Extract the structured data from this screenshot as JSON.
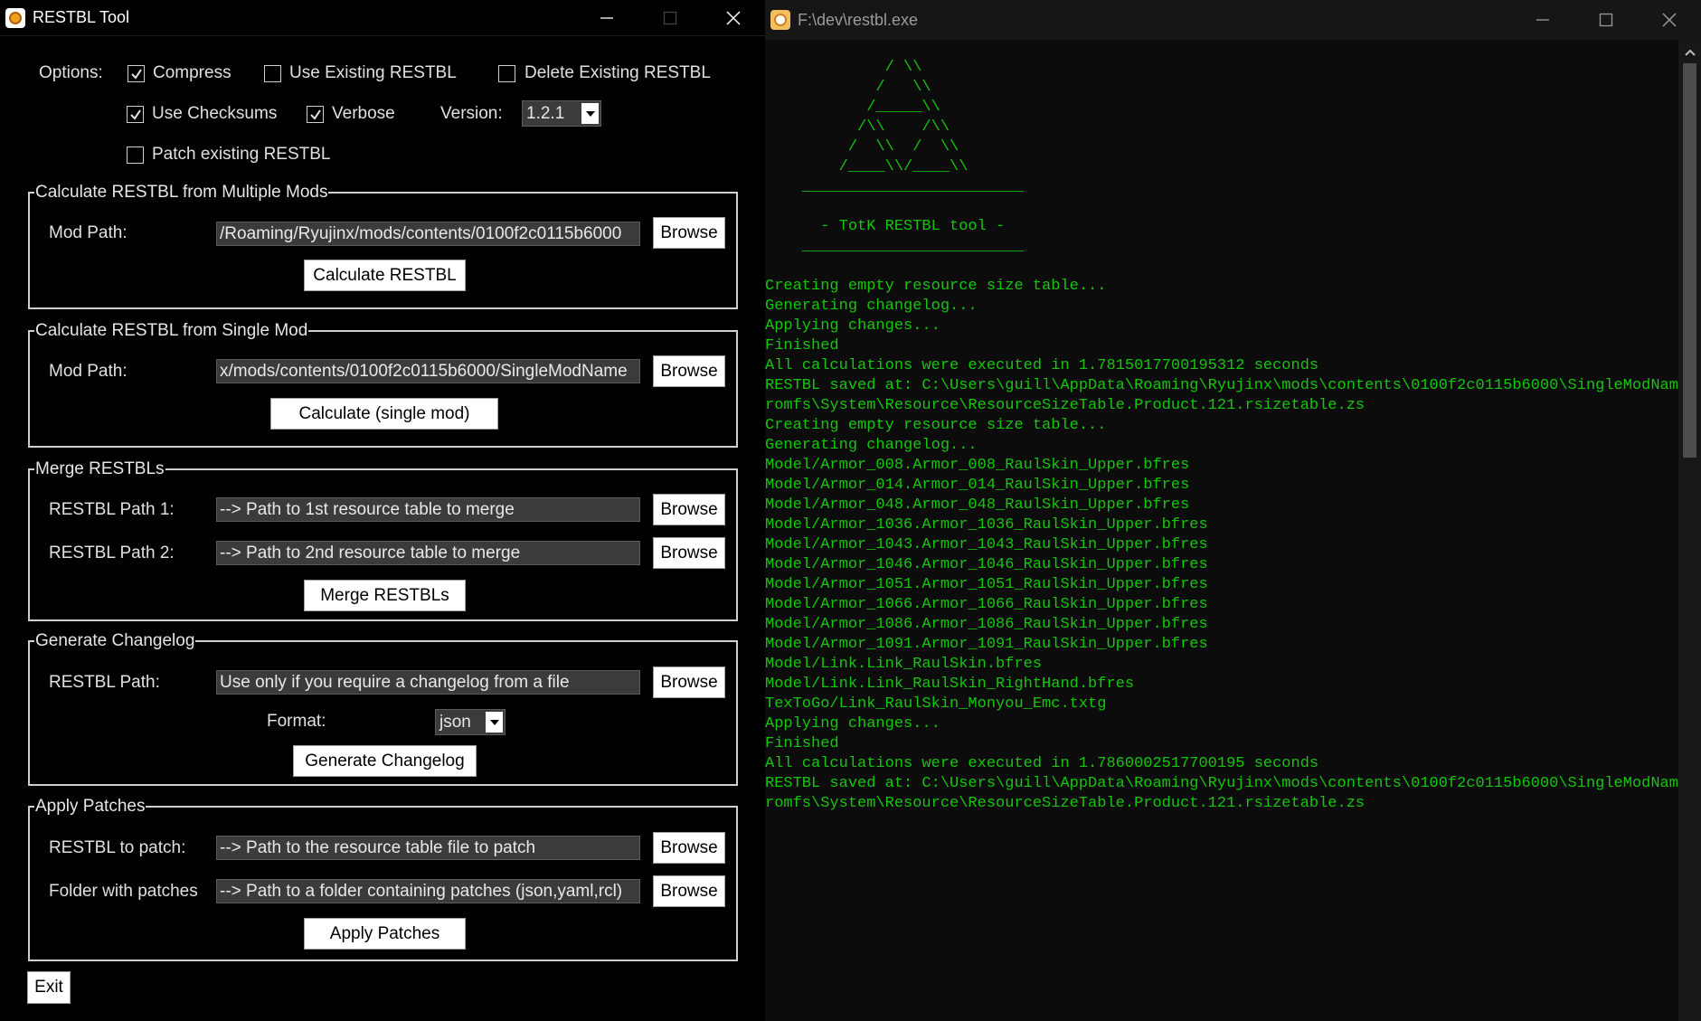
{
  "tool_window": {
    "title": "RESTBL Tool",
    "options": {
      "label": "Options:",
      "compress": {
        "label": "Compress",
        "checked": true
      },
      "use_existing": {
        "label": "Use Existing RESTBL",
        "checked": false
      },
      "delete_existing": {
        "label": "Delete Existing RESTBL",
        "checked": false
      },
      "use_checksums": {
        "label": "Use Checksums",
        "checked": true
      },
      "verbose": {
        "label": "Verbose",
        "checked": true
      },
      "version_label": "Version:",
      "version_value": "1.2.1",
      "patch_existing": {
        "label": "Patch existing RESTBL",
        "checked": false
      }
    },
    "multi": {
      "legend": "Calculate RESTBL from Multiple Mods",
      "mod_path_label": "Mod Path:",
      "mod_path_value": "/Roaming/Ryujinx/mods/contents/0100f2c0115b6000",
      "browse_label": "Browse",
      "calculate_label": "Calculate RESTBL"
    },
    "single": {
      "legend": "Calculate RESTBL from Single Mod",
      "mod_path_label": "Mod Path:",
      "mod_path_value": "x/mods/contents/0100f2c0115b6000/SingleModName",
      "browse_label": "Browse",
      "calculate_label": "Calculate (single mod)"
    },
    "merge": {
      "legend": "Merge RESTBLs",
      "path1_label": "RESTBL Path 1:",
      "path1_value": "--> Path to 1st resource table to merge",
      "path2_label": "RESTBL Path 2:",
      "path2_value": "--> Path to 2nd resource table to merge",
      "browse_label": "Browse",
      "merge_label": "Merge RESTBLs"
    },
    "changelog": {
      "legend": "Generate Changelog",
      "path_label": "RESTBL Path:",
      "path_value": "Use only if you require a changelog from a file",
      "browse_label": "Browse",
      "format_label": "Format:",
      "format_value": "json",
      "generate_label": "Generate Changelog"
    },
    "patches": {
      "legend": "Apply Patches",
      "restbl_label": "RESTBL to patch:",
      "restbl_value": "--> Path to the resource table file to patch",
      "folder_label": "Folder with patches",
      "folder_value": "--> Path to a folder containing patches (json,yaml,rcl)",
      "browse_label": "Browse",
      "apply_label": "Apply Patches"
    },
    "exit_label": "Exit"
  },
  "console_window": {
    "title": "F:\\dev\\restbl.exe",
    "lines": [
      "             / \\\\",
      "            /   \\\\",
      "           /_____\\\\",
      "          /\\\\    /\\\\",
      "         /  \\\\  /  \\\\",
      "        /____\\\\/____\\\\",
      "    ________________________",
      "",
      "      - TotK RESTBL tool -",
      "    ________________________",
      "",
      "Creating empty resource size table...",
      "Generating changelog...",
      "Applying changes...",
      "Finished",
      "All calculations were executed in 1.7815017700195312 seconds",
      "RESTBL saved at: C:\\Users\\guill\\AppData\\Roaming\\Ryujinx\\mods\\contents\\0100f2c0115b6000\\SingleModName\\",
      "romfs\\System\\Resource\\ResourceSizeTable.Product.121.rsizetable.zs",
      "Creating empty resource size table...",
      "Generating changelog...",
      "Model/Armor_008.Armor_008_RaulSkin_Upper.bfres",
      "Model/Armor_014.Armor_014_RaulSkin_Upper.bfres",
      "Model/Armor_048.Armor_048_RaulSkin_Upper.bfres",
      "Model/Armor_1036.Armor_1036_RaulSkin_Upper.bfres",
      "Model/Armor_1043.Armor_1043_RaulSkin_Upper.bfres",
      "Model/Armor_1046.Armor_1046_RaulSkin_Upper.bfres",
      "Model/Armor_1051.Armor_1051_RaulSkin_Upper.bfres",
      "Model/Armor_1066.Armor_1066_RaulSkin_Upper.bfres",
      "Model/Armor_1086.Armor_1086_RaulSkin_Upper.bfres",
      "Model/Armor_1091.Armor_1091_RaulSkin_Upper.bfres",
      "Model/Link.Link_RaulSkin.bfres",
      "Model/Link.Link_RaulSkin_RightHand.bfres",
      "TexToGo/Link_RaulSkin_Monyou_Emc.txtg",
      "Applying changes...",
      "Finished",
      "All calculations were executed in 1.7860002517700195 seconds",
      "RESTBL saved at: C:\\Users\\guill\\AppData\\Roaming\\Ryujinx\\mods\\contents\\0100f2c0115b6000\\SingleModName\\",
      "romfs\\System\\Resource\\ResourceSizeTable.Product.121.rsizetable.zs"
    ]
  },
  "colors": {
    "console_text": "#16c60c",
    "console_bg": "#0c0c0c",
    "tool_bg": "#000000",
    "input_bg": "#3b3b3b"
  }
}
